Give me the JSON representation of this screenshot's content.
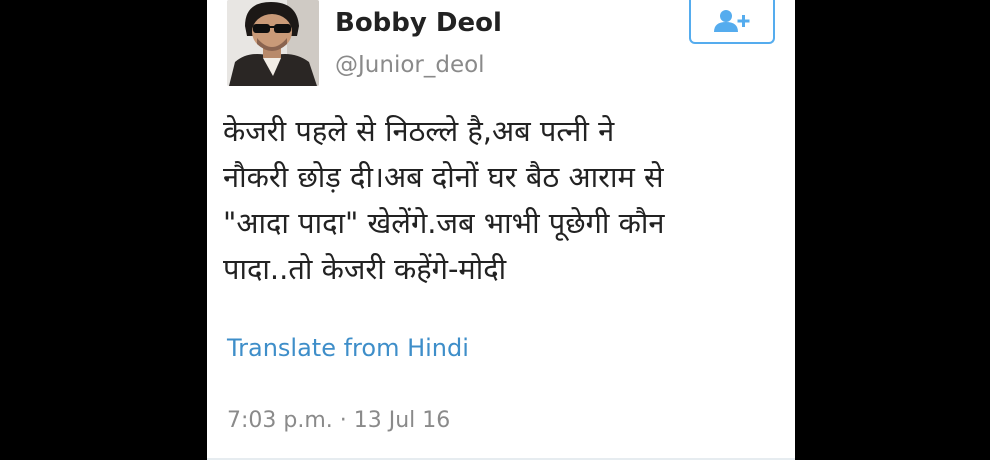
{
  "tweet": {
    "author": {
      "display_name": "Bobby Deol",
      "handle": "@Junior_deol"
    },
    "follow_button": {
      "icon": "add-user-icon",
      "color": "#55acee"
    },
    "text_lines": [
      "केजरी पहले से निठल्ले है,अब पत्नी ने",
      "नौकरी छोड़ दी।अब दोनों घर बैठ आराम से",
      "\"आदा पादा\" खेलेंगे.जब भाभी पूछेगी कौन",
      "पादा..तो केजरी कहेंगे-मोदी"
    ],
    "translate_label": "Translate from Hindi",
    "timestamp": "7:03 p.m. · 13 Jul 16"
  }
}
